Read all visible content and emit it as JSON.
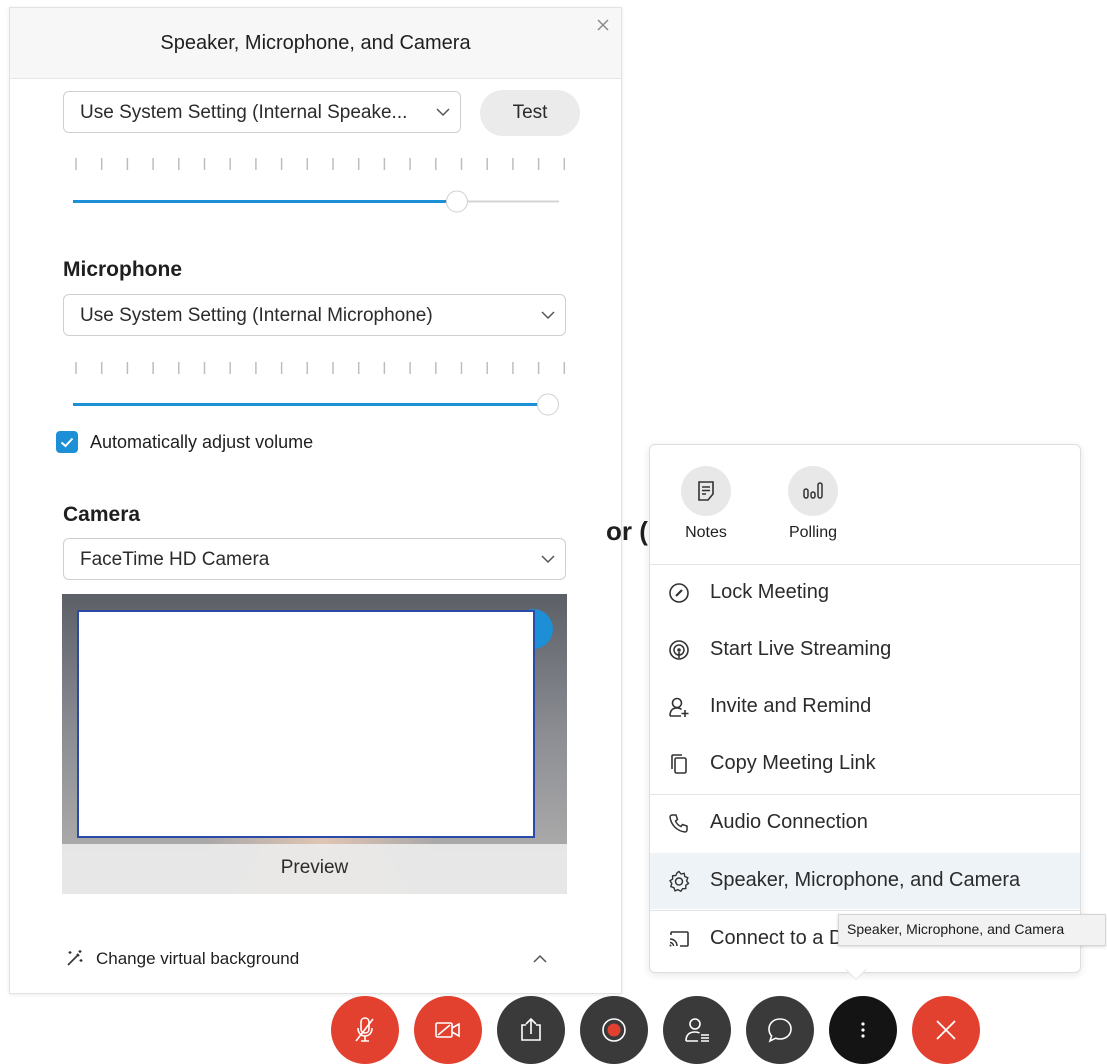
{
  "dialog": {
    "title": "Speaker, Microphone, and Camera",
    "speaker": {
      "device": "Use System Setting (Internal Speake...",
      "test_label": "Test",
      "volume_level": 0.79
    },
    "microphone": {
      "heading": "Microphone",
      "device": "Use System Setting (Internal Microphone)",
      "volume_level": 0.98,
      "auto_adjust_label": "Automatically adjust volume",
      "auto_adjust_checked": true
    },
    "camera": {
      "heading": "Camera",
      "device": "FaceTime HD Camera",
      "preview_label": "Preview"
    },
    "virtual_background_label": "Change virtual background"
  },
  "background_fragment": "or (",
  "more_menu": {
    "top_actions": [
      {
        "label": "Notes",
        "icon": "notes-icon"
      },
      {
        "label": "Polling",
        "icon": "polling-icon"
      }
    ],
    "items": [
      {
        "label": "Lock Meeting",
        "icon": "lock-meeting-icon"
      },
      {
        "label": "Start Live Streaming",
        "icon": "live-streaming-icon"
      },
      {
        "label": "Invite and Remind",
        "icon": "invite-icon"
      },
      {
        "label": "Copy Meeting Link",
        "icon": "copy-icon"
      },
      {
        "label": "Audio Connection",
        "icon": "phone-icon"
      },
      {
        "label": "Speaker, Microphone, and Camera",
        "icon": "gear-icon"
      },
      {
        "label": "Connect to a Device",
        "icon": "cast-icon"
      }
    ],
    "tooltip": "Speaker, Microphone, and Camera"
  },
  "controls": [
    {
      "name": "mute",
      "icon": "mic-off-icon"
    },
    {
      "name": "video",
      "icon": "video-off-icon"
    },
    {
      "name": "share",
      "icon": "share-icon"
    },
    {
      "name": "record",
      "icon": "record-icon"
    },
    {
      "name": "participants",
      "icon": "participants-icon"
    },
    {
      "name": "chat",
      "icon": "chat-icon"
    },
    {
      "name": "more",
      "icon": "more-icon"
    },
    {
      "name": "leave",
      "icon": "close-icon"
    }
  ],
  "colors": {
    "accent": "#1c8fd6",
    "danger": "#e3412f",
    "control_dark": "#3a3a3a",
    "highlight": "#eef3f8"
  }
}
